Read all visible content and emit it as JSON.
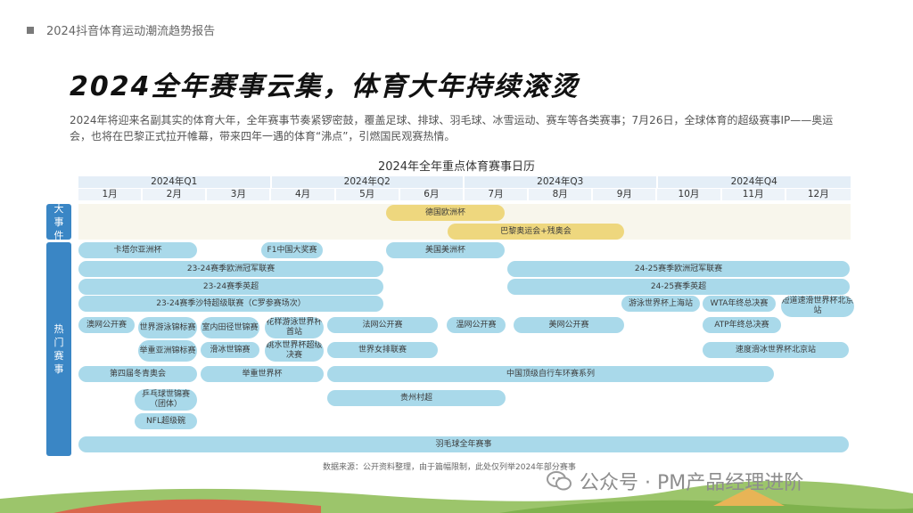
{
  "header": {
    "text": "2024抖音体育运动潮流趋势报告"
  },
  "title": "2024全年赛事云集，体育大年持续滚烫",
  "intro": "2024年将迎来名副其实的体育大年，全年赛事节奏紧锣密鼓，覆盖足球、排球、羽毛球、冰雪运动、赛车等各类赛事；7月26日，全球体育的超级赛事IP——奥运会，也将在巴黎正式拉开帷幕，带来四年一遇的体育“沸点”，引燃国民观赛热情。",
  "calendar": {
    "title": "2024年全年重点体育赛事日历",
    "quarters": [
      "2024年Q1",
      "2024年Q2",
      "2024年Q3",
      "2024年Q4"
    ],
    "months": [
      "1月",
      "2月",
      "3月",
      "4月",
      "5月",
      "6月",
      "7月",
      "8月",
      "9月",
      "10月",
      "11月",
      "12月"
    ],
    "sections": {
      "big_events": "大事件",
      "hot_events": "热门赛事"
    },
    "big_events": [
      "德国欧洲杯",
      "巴黎奥运会+残奥会"
    ],
    "hot_events": [
      "卡塔尔亚洲杯",
      "F1中国大奖赛",
      "美国美洲杯",
      "23-24赛季欧洲冠军联赛",
      "24-25赛季欧洲冠军联赛",
      "23-24赛季英超",
      "24-25赛季英超",
      "23-24赛季沙特超级联赛（C罗参赛场次）",
      "游泳世界杯上海站",
      "WTA年终总决赛",
      "短道速滑世界杯北京站",
      "澳网公开赛",
      "世界游泳锦标赛",
      "室内田径世锦赛",
      "花样游泳世界杯首站",
      "法网公开赛",
      "温网公开赛",
      "美网公开赛",
      "ATP年终总决赛",
      "举重亚洲锦标赛",
      "滑冰世锦赛",
      "跳水世界杯超级决赛",
      "世界女排联赛",
      "速度滑冰世界杯北京站",
      "第四届冬青奥会",
      "举重世界杯",
      "中国顶级自行车环赛系列",
      "乒乓球世锦赛（团体）",
      "贵州村超",
      "NFL超级碗",
      "羽毛球全年赛事"
    ]
  },
  "source": "数据来源：公开资料整理，由于篇幅限制，此处仅列举2024年部分赛事",
  "watermark": "公众号 · PM产品经理进阶"
}
